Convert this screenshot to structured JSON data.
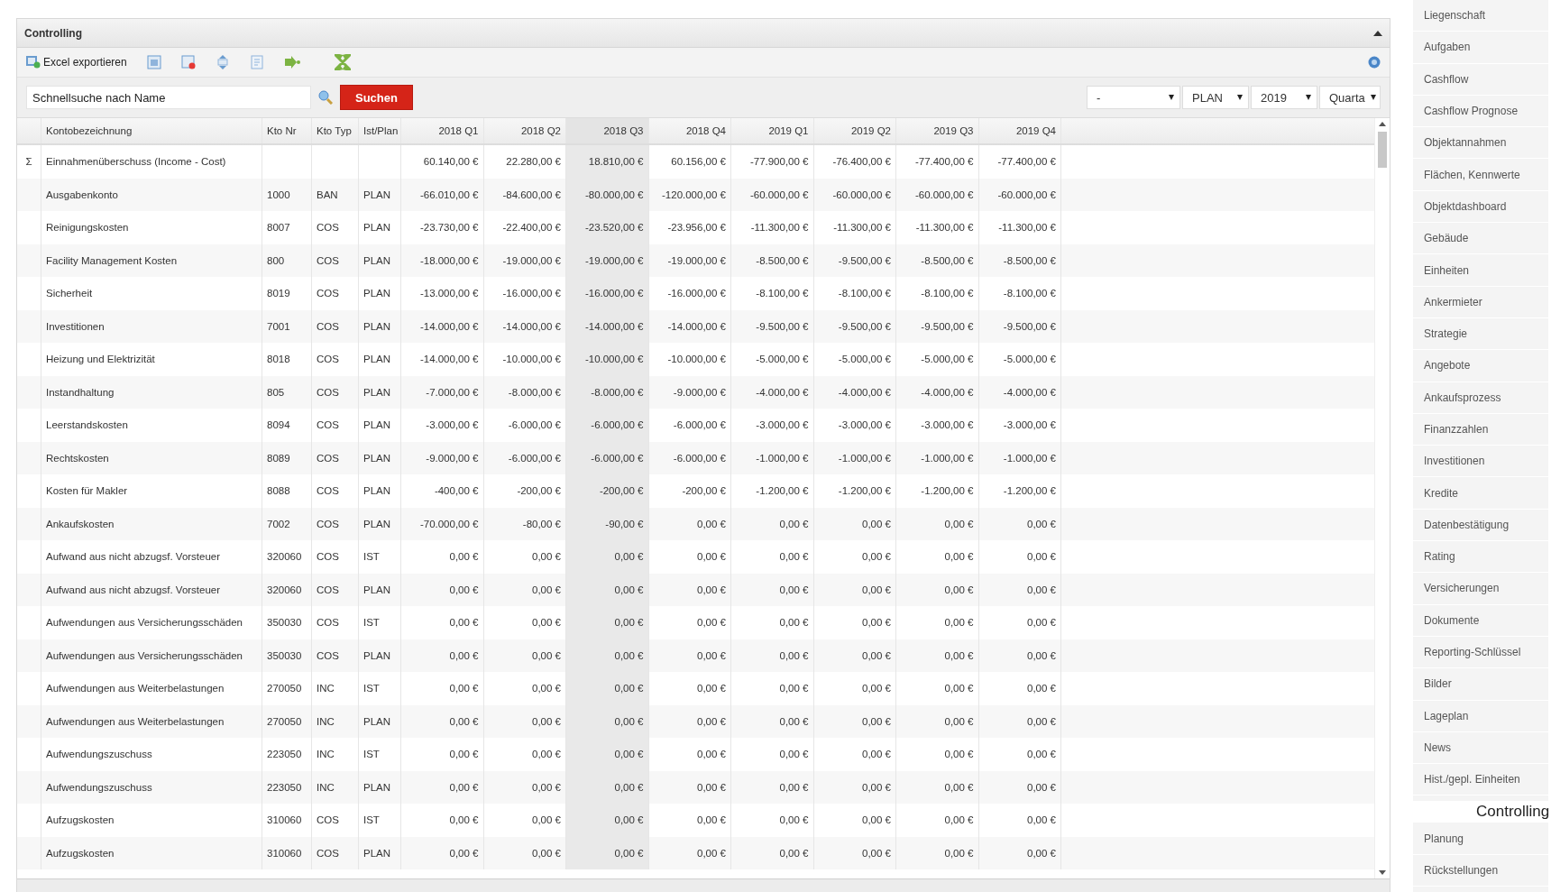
{
  "panel": {
    "title": "Controlling"
  },
  "toolbar": {
    "export_label": "Excel exportieren"
  },
  "search": {
    "placeholder": "Schnellsuche nach Name",
    "button": "Suchen"
  },
  "filters": [
    {
      "value": "-"
    },
    {
      "value": "PLAN"
    },
    {
      "value": "2019"
    },
    {
      "value": "Quarta"
    }
  ],
  "table": {
    "columns": [
      {
        "label": "Kontobezeichnung",
        "sorted": false
      },
      {
        "label": "Kto Nr",
        "sorted": false
      },
      {
        "label": "Kto Typ",
        "sorted": false
      },
      {
        "label": "Ist/Plan",
        "sorted": false
      },
      {
        "label": "2018 Q1",
        "sorted": false
      },
      {
        "label": "2018 Q2",
        "sorted": false
      },
      {
        "label": "2018 Q3",
        "sorted": true
      },
      {
        "label": "2018 Q4",
        "sorted": false
      },
      {
        "label": "2019 Q1",
        "sorted": false
      },
      {
        "label": "2019 Q2",
        "sorted": false
      },
      {
        "label": "2019 Q3",
        "sorted": false
      },
      {
        "label": "2019 Q4",
        "sorted": false
      }
    ],
    "rows": [
      {
        "marker": "Σ",
        "cells": [
          "Einnahmenüberschuss (Income - Cost)",
          "",
          "",
          "",
          "60.140,00 €",
          "22.280,00 €",
          "18.810,00 €",
          "60.156,00 €",
          "-77.900,00 €",
          "-76.400,00 €",
          "-77.400,00 €",
          "-77.400,00 €"
        ]
      },
      {
        "cells": [
          "Ausgabenkonto",
          "1000",
          "BAN",
          "PLAN",
          "-66.010,00 €",
          "-84.600,00 €",
          "-80.000,00 €",
          "-120.000,00 €",
          "-60.000,00 €",
          "-60.000,00 €",
          "-60.000,00 €",
          "-60.000,00 €"
        ]
      },
      {
        "cells": [
          "Reinigungskosten",
          "8007",
          "COS",
          "PLAN",
          "-23.730,00 €",
          "-22.400,00 €",
          "-23.520,00 €",
          "-23.956,00 €",
          "-11.300,00 €",
          "-11.300,00 €",
          "-11.300,00 €",
          "-11.300,00 €"
        ]
      },
      {
        "cells": [
          "Facility Management Kosten",
          "800",
          "COS",
          "PLAN",
          "-18.000,00 €",
          "-19.000,00 €",
          "-19.000,00 €",
          "-19.000,00 €",
          "-8.500,00 €",
          "-9.500,00 €",
          "-8.500,00 €",
          "-8.500,00 €"
        ]
      },
      {
        "cells": [
          "Sicherheit",
          "8019",
          "COS",
          "PLAN",
          "-13.000,00 €",
          "-16.000,00 €",
          "-16.000,00 €",
          "-16.000,00 €",
          "-8.100,00 €",
          "-8.100,00 €",
          "-8.100,00 €",
          "-8.100,00 €"
        ]
      },
      {
        "cells": [
          "Investitionen",
          "7001",
          "COS",
          "PLAN",
          "-14.000,00 €",
          "-14.000,00 €",
          "-14.000,00 €",
          "-14.000,00 €",
          "-9.500,00 €",
          "-9.500,00 €",
          "-9.500,00 €",
          "-9.500,00 €"
        ]
      },
      {
        "cells": [
          "Heizung und Elektrizität",
          "8018",
          "COS",
          "PLAN",
          "-14.000,00 €",
          "-10.000,00 €",
          "-10.000,00 €",
          "-10.000,00 €",
          "-5.000,00 €",
          "-5.000,00 €",
          "-5.000,00 €",
          "-5.000,00 €"
        ]
      },
      {
        "cells": [
          "Instandhaltung",
          "805",
          "COS",
          "PLAN",
          "-7.000,00 €",
          "-8.000,00 €",
          "-8.000,00 €",
          "-9.000,00 €",
          "-4.000,00 €",
          "-4.000,00 €",
          "-4.000,00 €",
          "-4.000,00 €"
        ]
      },
      {
        "cells": [
          "Leerstandskosten",
          "8094",
          "COS",
          "PLAN",
          "-3.000,00 €",
          "-6.000,00 €",
          "-6.000,00 €",
          "-6.000,00 €",
          "-3.000,00 €",
          "-3.000,00 €",
          "-3.000,00 €",
          "-3.000,00 €"
        ]
      },
      {
        "cells": [
          "Rechtskosten",
          "8089",
          "COS",
          "PLAN",
          "-9.000,00 €",
          "-6.000,00 €",
          "-6.000,00 €",
          "-6.000,00 €",
          "-1.000,00 €",
          "-1.000,00 €",
          "-1.000,00 €",
          "-1.000,00 €"
        ]
      },
      {
        "cells": [
          "Kosten für Makler",
          "8088",
          "COS",
          "PLAN",
          "-400,00 €",
          "-200,00 €",
          "-200,00 €",
          "-200,00 €",
          "-1.200,00 €",
          "-1.200,00 €",
          "-1.200,00 €",
          "-1.200,00 €"
        ]
      },
      {
        "cells": [
          "Ankaufskosten",
          "7002",
          "COS",
          "PLAN",
          "-70.000,00 €",
          "-80,00 €",
          "-90,00 €",
          "0,00 €",
          "0,00 €",
          "0,00 €",
          "0,00 €",
          "0,00 €"
        ]
      },
      {
        "cells": [
          "Aufwand aus nicht abzugsf. Vorsteuer",
          "320060",
          "COS",
          "IST",
          "0,00 €",
          "0,00 €",
          "0,00 €",
          "0,00 €",
          "0,00 €",
          "0,00 €",
          "0,00 €",
          "0,00 €"
        ]
      },
      {
        "cells": [
          "Aufwand aus nicht abzugsf. Vorsteuer",
          "320060",
          "COS",
          "PLAN",
          "0,00 €",
          "0,00 €",
          "0,00 €",
          "0,00 €",
          "0,00 €",
          "0,00 €",
          "0,00 €",
          "0,00 €"
        ]
      },
      {
        "cells": [
          "Aufwendungen aus Versicherungsschäden",
          "350030",
          "COS",
          "IST",
          "0,00 €",
          "0,00 €",
          "0,00 €",
          "0,00 €",
          "0,00 €",
          "0,00 €",
          "0,00 €",
          "0,00 €"
        ]
      },
      {
        "cells": [
          "Aufwendungen aus Versicherungsschäden",
          "350030",
          "COS",
          "PLAN",
          "0,00 €",
          "0,00 €",
          "0,00 €",
          "0,00 €",
          "0,00 €",
          "0,00 €",
          "0,00 €",
          "0,00 €"
        ]
      },
      {
        "cells": [
          "Aufwendungen aus Weiterbelastungen",
          "270050",
          "INC",
          "IST",
          "0,00 €",
          "0,00 €",
          "0,00 €",
          "0,00 €",
          "0,00 €",
          "0,00 €",
          "0,00 €",
          "0,00 €"
        ]
      },
      {
        "cells": [
          "Aufwendungen aus Weiterbelastungen",
          "270050",
          "INC",
          "PLAN",
          "0,00 €",
          "0,00 €",
          "0,00 €",
          "0,00 €",
          "0,00 €",
          "0,00 €",
          "0,00 €",
          "0,00 €"
        ]
      },
      {
        "cells": [
          "Aufwendungszuschuss",
          "223050",
          "INC",
          "IST",
          "0,00 €",
          "0,00 €",
          "0,00 €",
          "0,00 €",
          "0,00 €",
          "0,00 €",
          "0,00 €",
          "0,00 €"
        ]
      },
      {
        "cells": [
          "Aufwendungszuschuss",
          "223050",
          "INC",
          "PLAN",
          "0,00 €",
          "0,00 €",
          "0,00 €",
          "0,00 €",
          "0,00 €",
          "0,00 €",
          "0,00 €",
          "0,00 €"
        ]
      },
      {
        "cells": [
          "Aufzugskosten",
          "310060",
          "COS",
          "IST",
          "0,00 €",
          "0,00 €",
          "0,00 €",
          "0,00 €",
          "0,00 €",
          "0,00 €",
          "0,00 €",
          "0,00 €"
        ]
      },
      {
        "cells": [
          "Aufzugskosten",
          "310060",
          "COS",
          "PLAN",
          "0,00 €",
          "0,00 €",
          "0,00 €",
          "0,00 €",
          "0,00 €",
          "0,00 €",
          "0,00 €",
          "0,00 €"
        ]
      }
    ]
  },
  "sidebar": {
    "items": [
      "Liegenschaft",
      "Aufgaben",
      "Cashflow",
      "Cashflow Prognose",
      "Objektannahmen",
      "Flächen, Kennwerte",
      "Objektdashboard",
      "Gebäude",
      "Einheiten",
      "Ankermieter",
      "Strategie",
      "Angebote",
      "Ankaufsprozess",
      "Finanzzahlen",
      "Investitionen",
      "Kredite",
      "Datenbestätigung",
      "Rating",
      "Versicherungen",
      "Dokumente",
      "Reporting-Schlüssel",
      "Bilder",
      "Lageplan",
      "News",
      "Hist./gepl. Einheiten"
    ],
    "section_title": "Controlling",
    "section_items": [
      "Planung",
      "Rückstellungen"
    ]
  }
}
